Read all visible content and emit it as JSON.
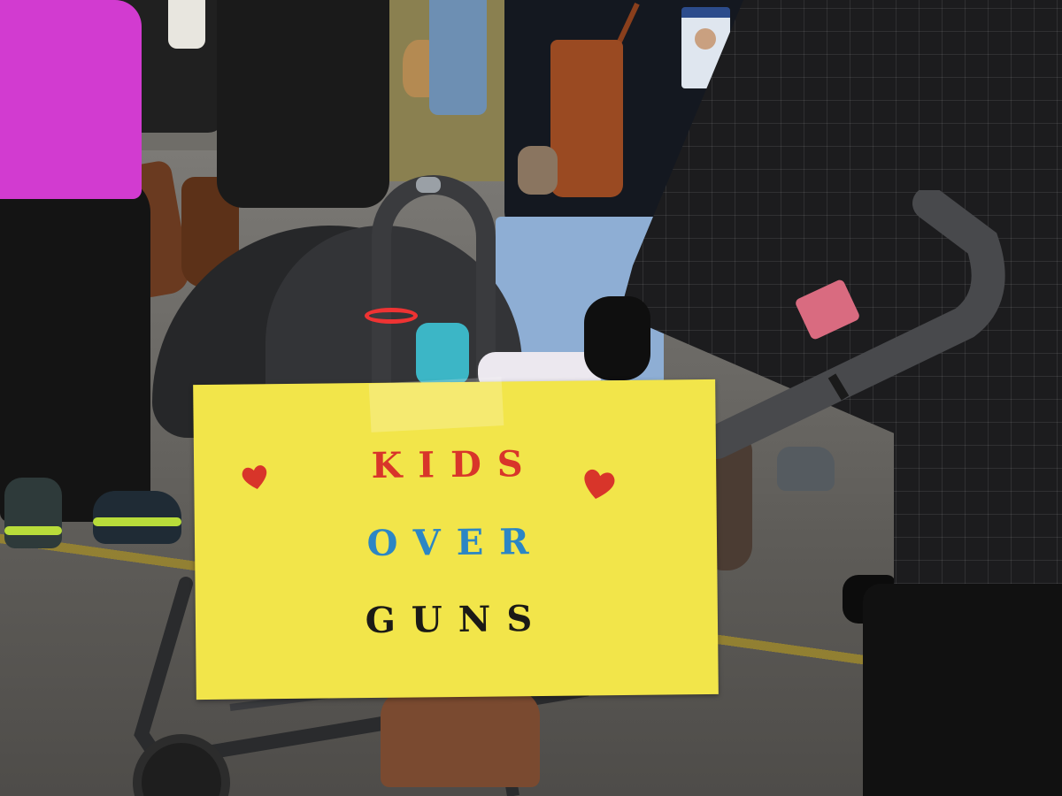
{
  "sign": {
    "line1": "KIDS",
    "line2": "OVER",
    "line3": "GUNS"
  },
  "colors": {
    "sign_background": "#f2e54a",
    "line1_text": "#d8352a",
    "line2_text": "#2c86c4",
    "line3_text": "#1b1a16",
    "heart": "#d8352a"
  },
  "icons": [
    "heart-icon",
    "heart-icon"
  ]
}
